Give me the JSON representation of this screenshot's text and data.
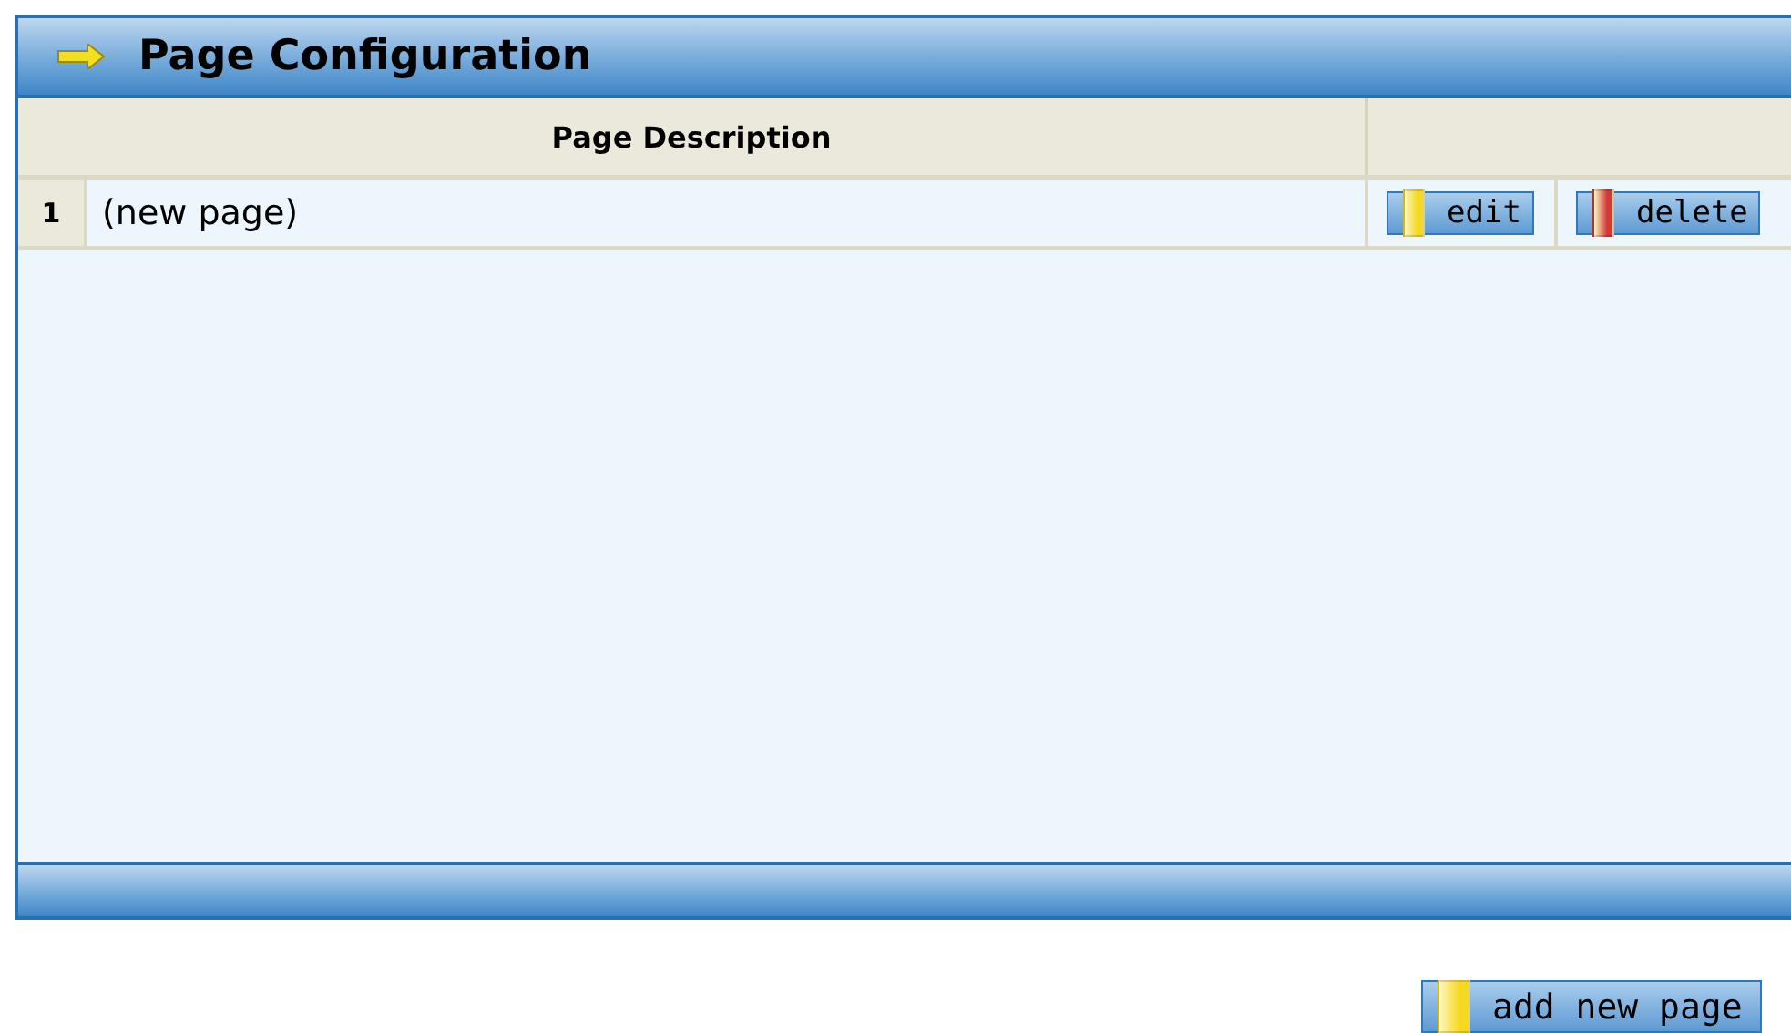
{
  "panel": {
    "title": "Page Configuration"
  },
  "table": {
    "columns": [
      "Page Description"
    ],
    "rows": [
      {
        "number": "1",
        "description": "(new page)",
        "actions": [
          {
            "label": "edit",
            "kind": "edit"
          },
          {
            "label": "delete",
            "kind": "delete"
          }
        ]
      }
    ]
  },
  "add_button": {
    "label": "add new page",
    "kind": "edit"
  }
}
